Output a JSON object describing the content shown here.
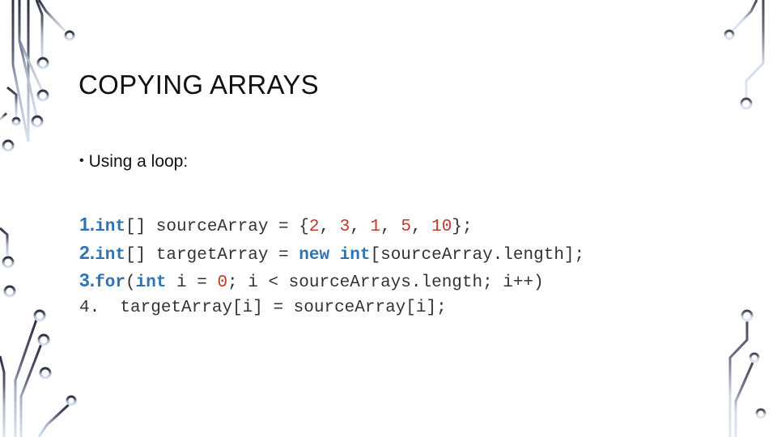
{
  "slide": {
    "title": "COPYING ARRAYS",
    "bullet_marker": "•",
    "bullet_text": "Using a loop:",
    "code_lines": [
      {
        "number": "1.",
        "tokens": [
          {
            "t": "int",
            "c": "kw"
          },
          {
            "t": "[] sourceArray = {",
            "c": ""
          },
          {
            "t": "2",
            "c": "lit"
          },
          {
            "t": ", ",
            "c": ""
          },
          {
            "t": "3",
            "c": "lit"
          },
          {
            "t": ", ",
            "c": ""
          },
          {
            "t": "1",
            "c": "lit"
          },
          {
            "t": ", ",
            "c": ""
          },
          {
            "t": "5",
            "c": "lit"
          },
          {
            "t": ", ",
            "c": ""
          },
          {
            "t": "10",
            "c": "lit"
          },
          {
            "t": "};",
            "c": ""
          }
        ]
      },
      {
        "number": "2.",
        "tokens": [
          {
            "t": "int",
            "c": "kw"
          },
          {
            "t": "[] targetArray = ",
            "c": ""
          },
          {
            "t": "new",
            "c": "kw"
          },
          {
            "t": " ",
            "c": ""
          },
          {
            "t": "int",
            "c": "kw"
          },
          {
            "t": "[sourceArray.length];",
            "c": ""
          }
        ]
      },
      {
        "number": "3.",
        "tokens": [
          {
            "t": "for",
            "c": "kw"
          },
          {
            "t": "(",
            "c": ""
          },
          {
            "t": "int",
            "c": "kw"
          },
          {
            "t": " i = ",
            "c": ""
          },
          {
            "t": "0",
            "c": "lit"
          },
          {
            "t": "; i < sourceArrays.length; i++)",
            "c": ""
          }
        ]
      },
      {
        "number": "4.",
        "plain_number": true,
        "tokens": [
          {
            "t": "  targetArray[i] = sourceArray[i];",
            "c": ""
          }
        ]
      }
    ]
  },
  "colors": {
    "keyword": "#2e74b5",
    "literal": "#c0392b",
    "text": "#333333",
    "circuit_dark": "#2c2f45",
    "circuit_light": "#c9d6ea"
  }
}
